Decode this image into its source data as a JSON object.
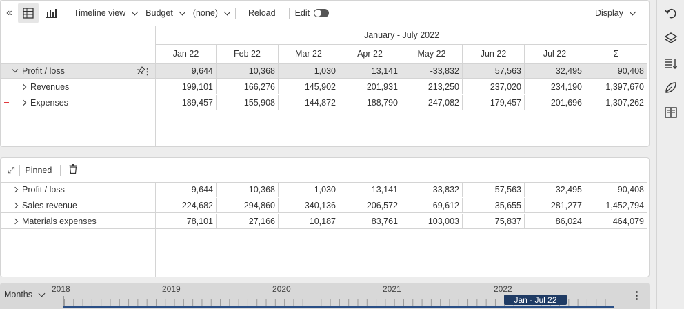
{
  "toolbar": {
    "collapse_icon": "double-chevron-left-icon",
    "view_table_icon": "table-icon",
    "view_chart_icon": "bar-chart-icon",
    "timeline_view_label": "Timeline view",
    "scenario_label": "Budget",
    "compare_label": "(none)",
    "reload_label": "Reload",
    "edit_label": "Edit",
    "display_label": "Display"
  },
  "grid": {
    "period_title": "January - July 2022",
    "columns": [
      "Jan 22",
      "Feb 22",
      "Mar 22",
      "Apr 22",
      "May 22",
      "Jun 22",
      "Jul 22",
      "Σ"
    ],
    "rows": [
      {
        "label": "Profit / loss",
        "values": [
          "9,644",
          "10,368",
          "1,030",
          "13,141",
          "-33,832",
          "57,563",
          "32,495",
          "90,408"
        ]
      },
      {
        "label": "Revenues",
        "values": [
          "199,101",
          "166,276",
          "145,902",
          "201,931",
          "213,250",
          "237,020",
          "234,190",
          "1,397,670"
        ]
      },
      {
        "label": "Expenses",
        "values": [
          "189,457",
          "155,908",
          "144,872",
          "188,790",
          "247,082",
          "179,457",
          "201,696",
          "1,307,262"
        ]
      }
    ]
  },
  "pinned": {
    "title": "Pinned",
    "rows": [
      {
        "label": "Profit / loss",
        "values": [
          "9,644",
          "10,368",
          "1,030",
          "13,141",
          "-33,832",
          "57,563",
          "32,495",
          "90,408"
        ]
      },
      {
        "label": "Sales revenue",
        "values": [
          "224,682",
          "294,860",
          "340,136",
          "206,572",
          "69,612",
          "35,655",
          "281,277",
          "1,452,794"
        ]
      },
      {
        "label": "Materials expenses",
        "values": [
          "78,101",
          "27,166",
          "10,187",
          "83,761",
          "103,003",
          "75,837",
          "86,024",
          "464,079"
        ]
      }
    ]
  },
  "timeline": {
    "granularity_label": "Months",
    "years": [
      "2018",
      "2019",
      "2020",
      "2021",
      "2022"
    ],
    "selected_range": "Jan - Jul 22"
  },
  "colors": {
    "accent": "#1f3b64",
    "negative_marker": "#e0393e"
  }
}
